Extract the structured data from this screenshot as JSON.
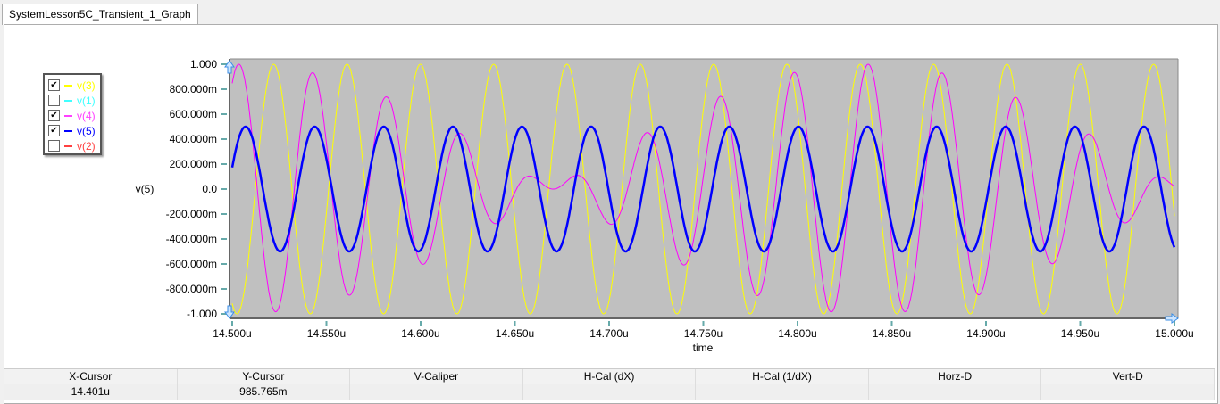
{
  "tab": {
    "label": "SystemLesson5C_Transient_1_Graph"
  },
  "legend": [
    {
      "label": "v(3)",
      "checked": true,
      "color": "#ffff00"
    },
    {
      "label": "v(1)",
      "checked": false,
      "color": "#40ffff"
    },
    {
      "label": "v(4)",
      "checked": true,
      "color": "#ff40ff"
    },
    {
      "label": "v(5)",
      "checked": true,
      "color": "#0000ff"
    },
    {
      "label": "v(2)",
      "checked": false,
      "color": "#ff4040"
    }
  ],
  "chart_data": {
    "type": "line",
    "xlabel": "time",
    "ylabel": "v(5)",
    "xlim": [
      14.5,
      15.0
    ],
    "ylim": [
      -1.0,
      1.0
    ],
    "x_unit": "us",
    "xticks": [
      "14.500u",
      "14.550u",
      "14.600u",
      "14.650u",
      "14.700u",
      "14.750u",
      "14.800u",
      "14.850u",
      "14.900u",
      "14.950u",
      "15.000u"
    ],
    "yticks": [
      "1.000",
      "800.000m",
      "600.000m",
      "400.000m",
      "200.000m",
      "0.0",
      "-200.000m",
      "-400.000m",
      "-600.000m",
      "-800.000m",
      "-1.000"
    ],
    "plot_background": "#c0c0c0",
    "series": [
      {
        "name": "v(3)",
        "color": "#ffff00",
        "model": "A*cos(2*pi*f*(t-t0))",
        "amplitude": 1.0,
        "freq_MHz": 25.7,
        "t0_us": 14.522
      },
      {
        "name": "v(4)",
        "color": "#ff00ff",
        "model": "A*cos(2*pi*f*(t-t0))*cos(pi*fd*(t-t0))",
        "amplitude": 1.0,
        "freq_MHz": 25.45,
        "beat_MHz": 3.0,
        "t0_us": 14.5035
      },
      {
        "name": "v(5)",
        "color": "#0000ff",
        "model": "A*cos(2*pi*f*(t-t0))",
        "amplitude": 0.5,
        "freq_MHz": 27.27,
        "t0_us": 14.5071
      }
    ]
  },
  "cursor_table": {
    "headers": [
      "X-Cursor",
      "Y-Cursor",
      "V-Caliper",
      "H-Cal (dX)",
      "H-Cal (1/dX)",
      "Horz-D",
      "Vert-D"
    ],
    "values": [
      "14.401u",
      "985.765m",
      "",
      "",
      "",
      "",
      ""
    ]
  }
}
